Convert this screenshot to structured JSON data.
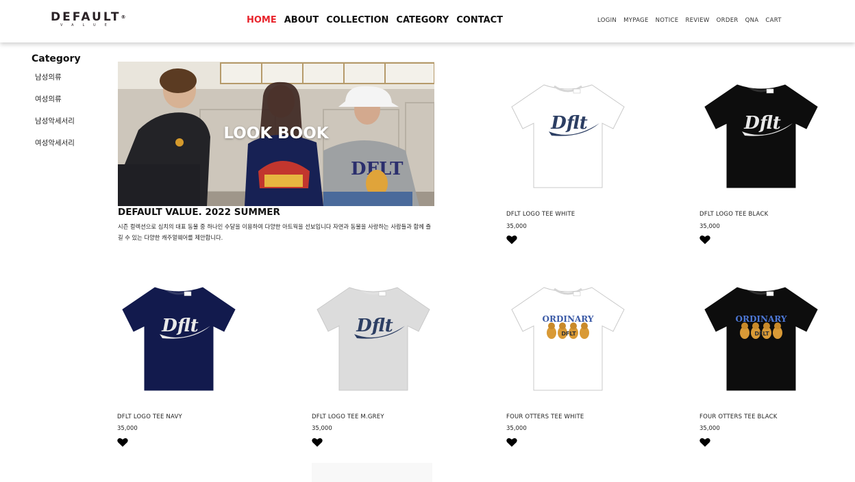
{
  "header": {
    "logo_main": "DEFAULT",
    "logo_sub": "VALUE",
    "nav": [
      "HOME",
      "ABOUT",
      "COLLECTION",
      "CATEGORY",
      "CONTACT"
    ],
    "active_nav": "HOME",
    "util": [
      "LOGIN",
      "MYPAGE",
      "NOTICE",
      "REVIEW",
      "ORDER",
      "QNA",
      "CART"
    ],
    "accent_color": "#e8242c"
  },
  "sidebar": {
    "title": "Category",
    "items": [
      "남성의류",
      "여성의류",
      "남성악세서리",
      "여성악세서리"
    ]
  },
  "lookbook": {
    "overlay": "LOOK BOOK",
    "title": "DEFAULT VALUE. 2022 SUMMER",
    "desc": "시즌 컬렉션으로 심치의 대표 동물 중 하나인 수달을 이용하여 다양한 아트웍을 선보입니다 자연과 동물을 사랑하는 사람들과 함께 즐길 수 있는 다양한 캐주얼웨어를 제안합니다."
  },
  "products": [
    {
      "name": "DFLT LOGO TEE WHITE",
      "price": "35,000",
      "shirt": "#ffffff",
      "graphic": "logo",
      "graphic_color": "#2c3e63"
    },
    {
      "name": "DFLT LOGO TEE BLACK",
      "price": "35,000",
      "shirt": "#0d0d0d",
      "graphic": "logo",
      "graphic_color": "#e9e9e9"
    },
    {
      "name": "DFLT LOGO TEE NAVY",
      "price": "35,000",
      "shirt": "#121a4d",
      "graphic": "logo",
      "graphic_color": "#e9e9e9"
    },
    {
      "name": "DFLT LOGO TEE M.GREY",
      "price": "35,000",
      "shirt": "#dcdcdc",
      "graphic": "logo",
      "graphic_color": "#2c3e63"
    },
    {
      "name": "FOUR OTTERS TEE WHITE",
      "price": "35,000",
      "shirt": "#ffffff",
      "graphic": "otters",
      "graphic_color": "#3b5aa6"
    },
    {
      "name": "FOUR OTTERS TEE BLACK",
      "price": "35,000",
      "shirt": "#0d0d0d",
      "graphic": "otters",
      "graphic_color": "#4d78d6"
    }
  ]
}
